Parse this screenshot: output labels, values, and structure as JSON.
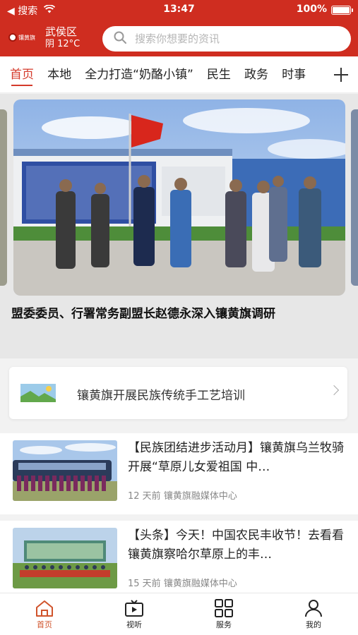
{
  "status_bar": {
    "back_label": "◀ 搜索",
    "time": "13:47",
    "battery": "100%",
    "battery_level": 1.0
  },
  "header": {
    "logo_text": "镶黄旗",
    "location": "武侯区",
    "weather": "阴 12°C",
    "search_placeholder": "搜索你想要的资讯",
    "search_value": "",
    "accent_color": "#cf2d20"
  },
  "tabs": [
    {
      "label": "首页",
      "active": true
    },
    {
      "label": "本地",
      "active": false
    },
    {
      "label": "全力打造“奶酪小镇”",
      "active": false
    },
    {
      "label": "民生",
      "active": false
    },
    {
      "label": "政务",
      "active": false
    },
    {
      "label": "时事",
      "active": false
    }
  ],
  "hero": {
    "title": "盟委委员、行署常务副盟长赵德永深入镶黄旗调研"
  },
  "notice": {
    "icon": "image-placeholder-icon",
    "text": "镶黄旗开展民族传统手工艺培训"
  },
  "news": [
    {
      "title": "【民族团结进步活动月】镶黄旗乌兰牧骑开展“草原儿女爱祖国 中…",
      "time": "12 天前",
      "source": "镶黄旗融媒体中心"
    },
    {
      "title": "【头条】今天！中国农民丰收节！去看看镶黄旗察哈尔草原上的丰…",
      "time": "15 天前",
      "source": "镶黄旗融媒体中心"
    }
  ],
  "bottom_nav": [
    {
      "label": "首页",
      "icon": "home-icon",
      "active": true
    },
    {
      "label": "视听",
      "icon": "video-icon",
      "active": false
    },
    {
      "label": "服务",
      "icon": "grid-icon",
      "active": false
    },
    {
      "label": "我的",
      "icon": "user-icon",
      "active": false
    }
  ]
}
